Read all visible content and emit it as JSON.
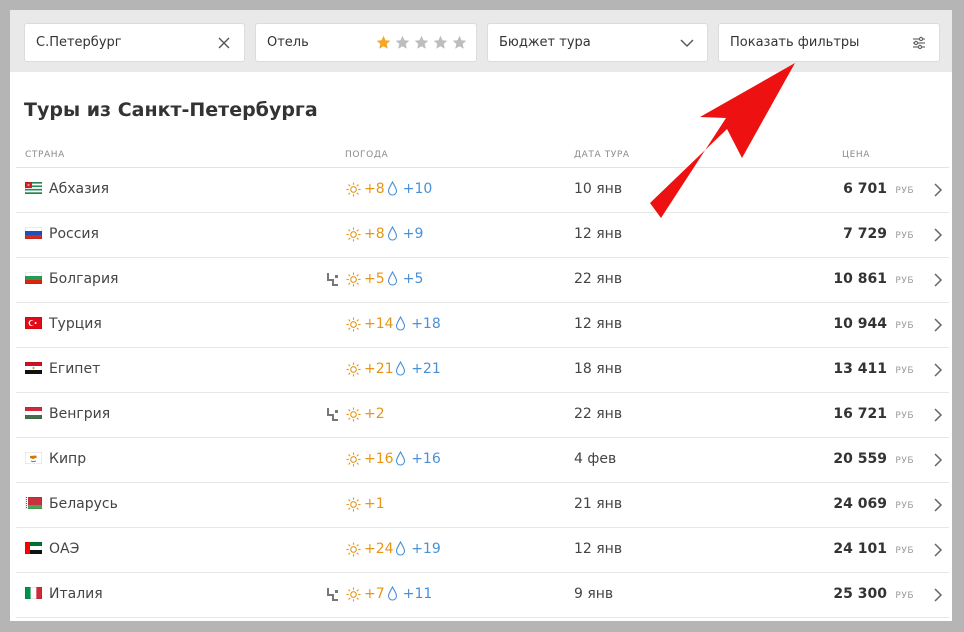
{
  "filters": {
    "city": "С.Петербург",
    "hotel": "Отель",
    "hotel_stars_selected": 1,
    "budget": "Бюджет тура",
    "show_filters": "Показать фильтры"
  },
  "page": {
    "title": "Туры из Санкт-Петербурга"
  },
  "table": {
    "headers": [
      "СТРАНА",
      "ПОГОДА",
      "ДАТА ТУРА",
      "ЦЕНА"
    ],
    "currency": "РУБ",
    "rows": [
      {
        "country": "Абхазия",
        "flag": "abkhazia",
        "ski": false,
        "air": "+8",
        "water": "+10",
        "date": "10 янв",
        "price": "6 701"
      },
      {
        "country": "Россия",
        "flag": "russia",
        "ski": false,
        "air": "+8",
        "water": "+9",
        "date": "12 янв",
        "price": "7 729"
      },
      {
        "country": "Болгария",
        "flag": "bulgaria",
        "ski": true,
        "air": "+5",
        "water": "+5",
        "date": "22 янв",
        "price": "10 861"
      },
      {
        "country": "Турция",
        "flag": "turkey",
        "ski": false,
        "air": "+14",
        "water": "+18",
        "date": "12 янв",
        "price": "10 944"
      },
      {
        "country": "Египет",
        "flag": "egypt",
        "ski": false,
        "air": "+21",
        "water": "+21",
        "date": "18 янв",
        "price": "13 411"
      },
      {
        "country": "Венгрия",
        "flag": "hungary",
        "ski": true,
        "air": "+2",
        "water": "",
        "date": "22 янв",
        "price": "16 721"
      },
      {
        "country": "Кипр",
        "flag": "cyprus",
        "ski": false,
        "air": "+16",
        "water": "+16",
        "date": "4 фев",
        "price": "20 559"
      },
      {
        "country": "Беларусь",
        "flag": "belarus",
        "ski": false,
        "air": "+1",
        "water": "",
        "date": "21 янв",
        "price": "24 069"
      },
      {
        "country": "ОАЭ",
        "flag": "uae",
        "ski": false,
        "air": "+24",
        "water": "+19",
        "date": "12 янв",
        "price": "24 101"
      },
      {
        "country": "Италия",
        "flag": "italy",
        "ski": true,
        "air": "+7",
        "water": "+11",
        "date": "9 янв",
        "price": "25 300"
      }
    ]
  },
  "colors": {
    "air_temp": "#e69516",
    "water_temp": "#4a90d9",
    "star_active": "#f5a623",
    "star_inactive": "#bdbdbd",
    "annotation_arrow": "#ee1111"
  }
}
